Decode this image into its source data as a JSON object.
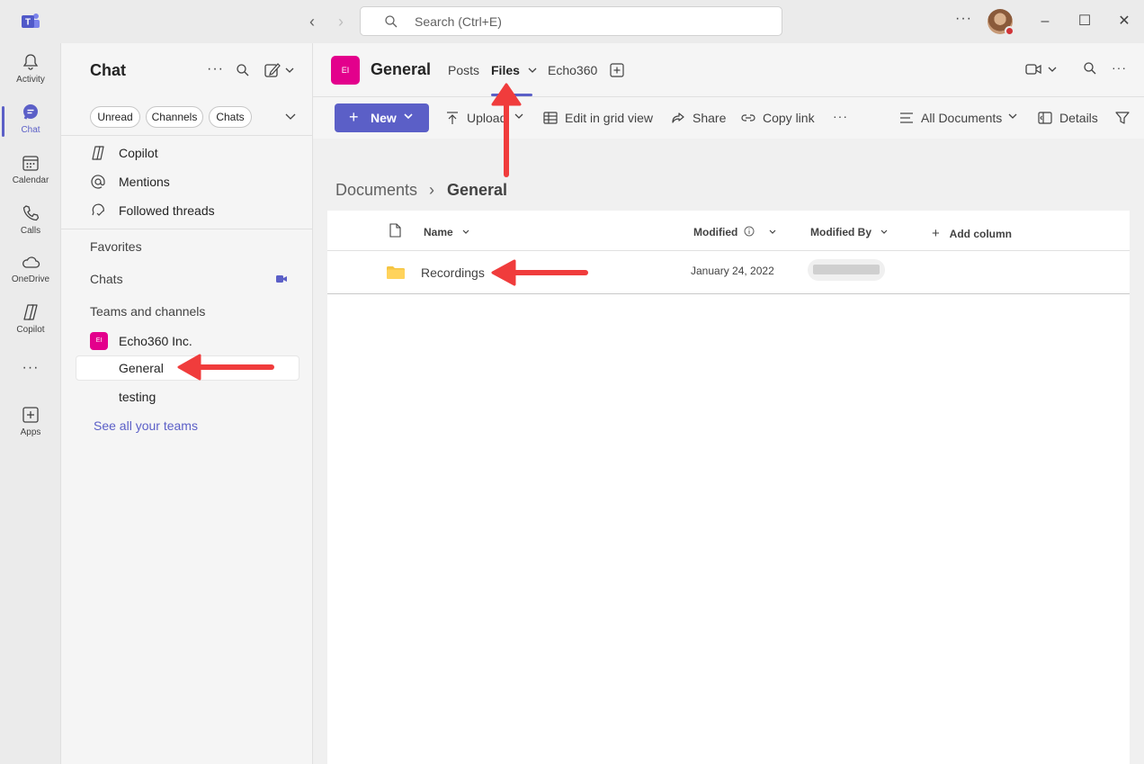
{
  "titlebar": {
    "search_placeholder": "Search (Ctrl+E)",
    "more": "···"
  },
  "rail": {
    "items": [
      {
        "label": "Activity",
        "icon": "bell-icon"
      },
      {
        "label": "Chat",
        "icon": "chat-icon"
      },
      {
        "label": "Calendar",
        "icon": "calendar-icon"
      },
      {
        "label": "Calls",
        "icon": "phone-icon"
      },
      {
        "label": "OneDrive",
        "icon": "cloud-icon"
      },
      {
        "label": "Copilot",
        "icon": "copilot-icon"
      },
      {
        "label": "Apps",
        "icon": "add-app-icon"
      }
    ],
    "more": "···"
  },
  "sidebar": {
    "title": "Chat",
    "filters": [
      "Unread",
      "Channels",
      "Chats"
    ],
    "quick": [
      {
        "label": "Copilot",
        "icon": "copilot-icon"
      },
      {
        "label": "Mentions",
        "icon": "at-icon"
      },
      {
        "label": "Followed threads",
        "icon": "followed-threads-icon"
      }
    ],
    "sections": {
      "favorites": "Favorites",
      "chats": "Chats",
      "teams": "Teams and channels"
    },
    "team": {
      "initials": "EI",
      "name": "Echo360 Inc."
    },
    "channels": [
      "General",
      "testing"
    ],
    "see_all": "See all your teams"
  },
  "header": {
    "channel_initials": "EI",
    "channel_name": "General",
    "tabs": [
      "Posts",
      "Files",
      "Echo360"
    ],
    "active_tab": "Files"
  },
  "toolbar": {
    "new_label": "New",
    "upload_label": "Upload",
    "grid_label": "Edit in grid view",
    "share_label": "Share",
    "copy_label": "Copy link",
    "more": "···",
    "view_label": "All Documents",
    "details_label": "Details"
  },
  "content": {
    "breadcrumb_root": "Documents",
    "breadcrumb_sep": "›",
    "breadcrumb_current": "General",
    "columns": {
      "name": "Name",
      "modified": "Modified",
      "modified_by": "Modified By",
      "add_column": "Add column"
    },
    "rows": [
      {
        "name": "Recordings",
        "modified": "January 24, 2022"
      }
    ]
  },
  "colors": {
    "brand": "#5b5fc7",
    "team_avatar": "#e3008c",
    "annotation_arrow": "#f03c3c",
    "folder": "#f5c542"
  }
}
